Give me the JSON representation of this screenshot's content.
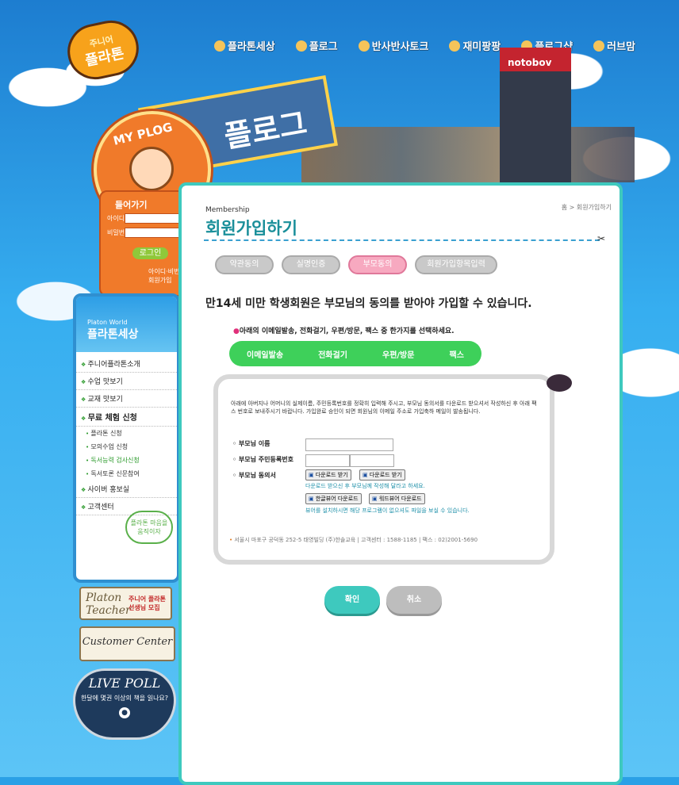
{
  "logo": {
    "top": "주니어",
    "main": "플라톤"
  },
  "topnav": [
    {
      "label": "플라톤세상"
    },
    {
      "label": "플로그"
    },
    {
      "label": "반사반사토크"
    },
    {
      "label": "재미팡팡"
    },
    {
      "label": "플로그샵"
    },
    {
      "label": "러브맘"
    }
  ],
  "scene": {
    "myplog": "MY PLOG",
    "sign": "플로그",
    "tower": "notobov"
  },
  "login": {
    "title": "들어가기",
    "id_label": "아이디",
    "pw_label": "비밀번호",
    "button": "로그인",
    "link1": "아이디·비번찾기",
    "link2": "회원가입"
  },
  "sidebar": {
    "title_en": "Platon World",
    "title_ko": "플라톤세상",
    "items": [
      {
        "label": "주니어플라톤소개"
      },
      {
        "label": "수업 맛보기"
      },
      {
        "label": "교재 맛보기"
      },
      {
        "label": "무료 체험 신청"
      },
      {
        "label": "플라톤 신청"
      },
      {
        "label": "모의수업 신청"
      },
      {
        "label": "독서능력 검사신청"
      },
      {
        "label": "독서토론 신문참여"
      },
      {
        "label": "사이버 홍보실"
      },
      {
        "label": "고객센터"
      }
    ],
    "bubble": "플라톤 마음을 움직이자"
  },
  "banners": {
    "teacher": "Platon Teacher",
    "teacher_sub": "주니어 플라톤 선생님 모집",
    "customer": "Customer Center"
  },
  "poll": {
    "title": "LIVE POLL",
    "question": "한달에 몇권 이상의 책을 읽나요?"
  },
  "main": {
    "breadcrumb": "홈 > 회원가입하기",
    "title_en": "Membership",
    "title_ko": "회원가입하기",
    "steps": [
      {
        "label": "약관동의"
      },
      {
        "label": "실명인증"
      },
      {
        "label": "부모동의"
      },
      {
        "label": "회원가입항목입력"
      }
    ],
    "headline": "만14세 미만 학생회원은 부모님의 동의를 받아야 가입할 수 있습니다.",
    "choose": "아래의 이메일발송, 전화걸기, 우편/방문, 팩스 중 한가지를 선택하세요.",
    "options": [
      {
        "label": "이메일발송"
      },
      {
        "label": "전화걸기"
      },
      {
        "label": "우편/방문"
      },
      {
        "label": "팩스"
      }
    ],
    "notice": "아래에 아버지나 어머니의 실제이름, 주민등록번호를 정확히 입력해 주시고, 부모님 동의서를 다운로드 받으셔서 작성하신 후 아래 팩스 번호로 보내주시기 바랍니다. 가입완료 승인이 되면 회원님의 이메일 주소로 가입축하 메일이 발송됩니다.",
    "form": {
      "name_label": "부모님 이름",
      "ssn_label": "부모님 주민등록번호",
      "consent_label": "부모님 동의서",
      "dl1": "다운로드 받기",
      "dl2": "다운로드 받기",
      "note1": "다운로드 받으신 후 부모님께 작성해 달라고 하세요.",
      "viewer1": "한글뷰어 다운로드",
      "viewer2": "워드뷰어 다운로드",
      "note2": "뷰어를 설치하시면 해당 프로그램이 없으셔도 파일을 보실 수 있습니다.",
      "address": "서울시 마포구 공덕동 252-5 태영빌딩 (주)한솔교육 | 고객센터 : 1588-1185 | 팩스 : 02)2001-5690"
    },
    "ok_button": "확인",
    "cancel_button": "취소"
  },
  "colors": {
    "sky": "#2aa0e6",
    "teal": "#3ec9be",
    "green": "#3ed05a",
    "orange": "#f07a2a"
  }
}
